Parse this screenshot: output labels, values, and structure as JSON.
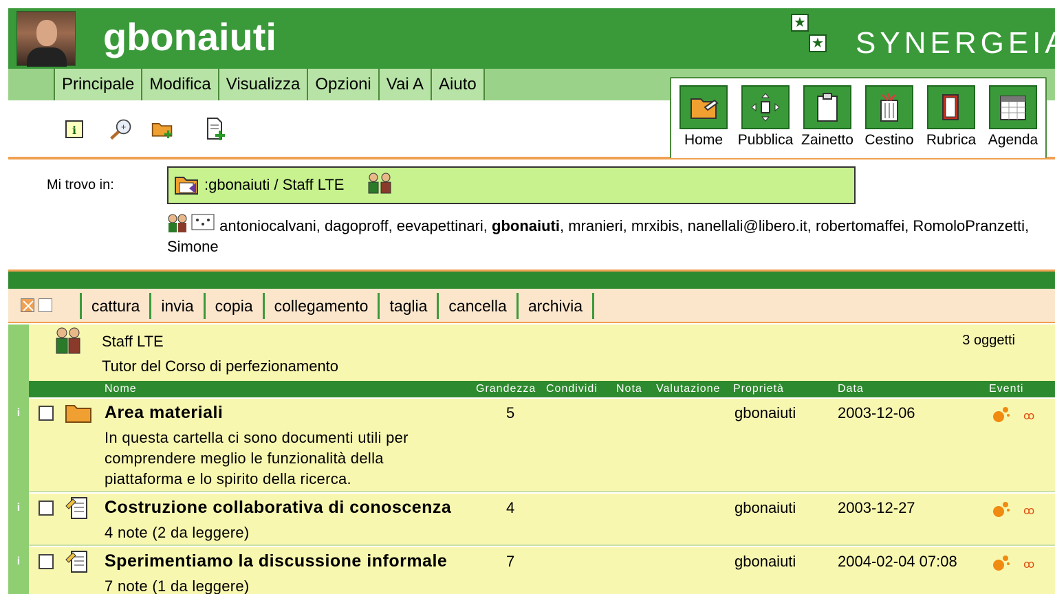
{
  "header": {
    "username": "gbonaiuti",
    "logo_text": "SYNERGEIA"
  },
  "menu": [
    "Principale",
    "Modifica",
    "Visualizza",
    "Opzioni",
    "Vai A",
    "Aiuto"
  ],
  "big_buttons": [
    "Home",
    "Pubblica",
    "Zainetto",
    "Cestino",
    "Rubrica",
    "Agenda"
  ],
  "location": {
    "label": "Mi trovo in:",
    "path": ":gbonaiuti / Staff LTE"
  },
  "members": {
    "before": "antoniocalvani, dagoproff, eevapettinari, ",
    "current": "gbonaiuti",
    "after": ", mranieri, mrxibis, nanellali@libero.it, robertomaffei, RomoloPranzetti, Simone"
  },
  "actions": [
    "cattura",
    "invia",
    "copia",
    "collegamento",
    "taglia",
    "cancella",
    "archivia"
  ],
  "folder": {
    "title": "Staff LTE",
    "description": "Tutor del Corso di perfezionamento",
    "count": "3 oggetti"
  },
  "columns": {
    "name": "Nome",
    "size": "Grandezza",
    "share": "Condividi",
    "note": "Nota",
    "rating": "Valutazione",
    "owner": "Proprietà",
    "date": "Data",
    "events": "Eventi"
  },
  "rows": [
    {
      "icon": "folder-icon",
      "title": "Area materiali",
      "description": "In questa cartella ci sono documenti utili per comprendere meglio le funzionalità della piattaforma e lo spirito della ricerca.",
      "size": "5",
      "owner": "gbonaiuti",
      "date": "2003-12-06"
    },
    {
      "icon": "discussion-icon",
      "title": "Costruzione collaborativa di conoscenza",
      "description": "4 note (2 da leggere)",
      "size": "4",
      "owner": "gbonaiuti",
      "date": "2003-12-27"
    },
    {
      "icon": "discussion-icon",
      "title": "Sperimentiamo la discussione informale",
      "description": "7 note (1 da leggere)",
      "size": "7",
      "owner": "gbonaiuti",
      "date": "2004-02-04 07:08"
    }
  ],
  "colors": {
    "header_green": "#3a9a3a",
    "menu_green": "#9bd289",
    "location_box": "#c7f28e",
    "list_bg": "#f8f7b0",
    "accent_orange": "#f0a050"
  }
}
